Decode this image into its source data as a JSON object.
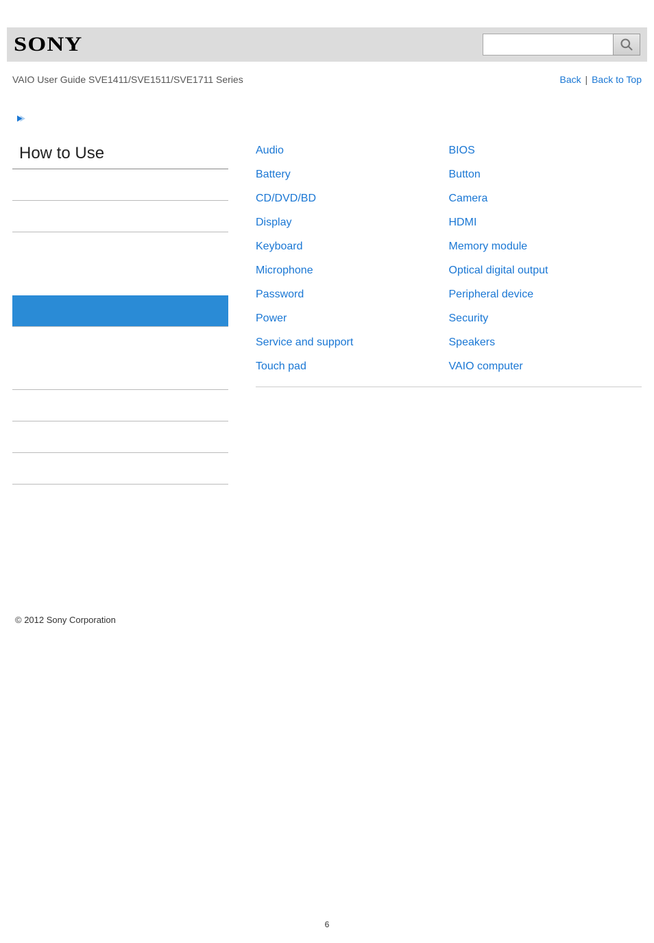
{
  "header": {
    "logo_text": "SONY",
    "search_placeholder": ""
  },
  "subheader": {
    "title": "VAIO User Guide SVE1411/SVE1511/SVE1711 Series",
    "back_label": "Back",
    "back_to_top_label": "Back to Top",
    "separator": " | "
  },
  "sidebar": {
    "title": "How to Use"
  },
  "content": {
    "left_links": [
      "Audio",
      "Battery",
      "CD/DVD/BD",
      "Display",
      "Keyboard",
      "Microphone",
      "Password",
      "Power",
      "Service and support",
      "Touch pad"
    ],
    "right_links": [
      "BIOS",
      "Button",
      "Camera",
      "HDMI",
      "Memory module",
      "Optical digital output",
      "Peripheral device",
      "Security",
      "Speakers",
      "VAIO computer"
    ]
  },
  "footer": {
    "copyright": "© 2012 Sony Corporation"
  },
  "page_number": "6"
}
